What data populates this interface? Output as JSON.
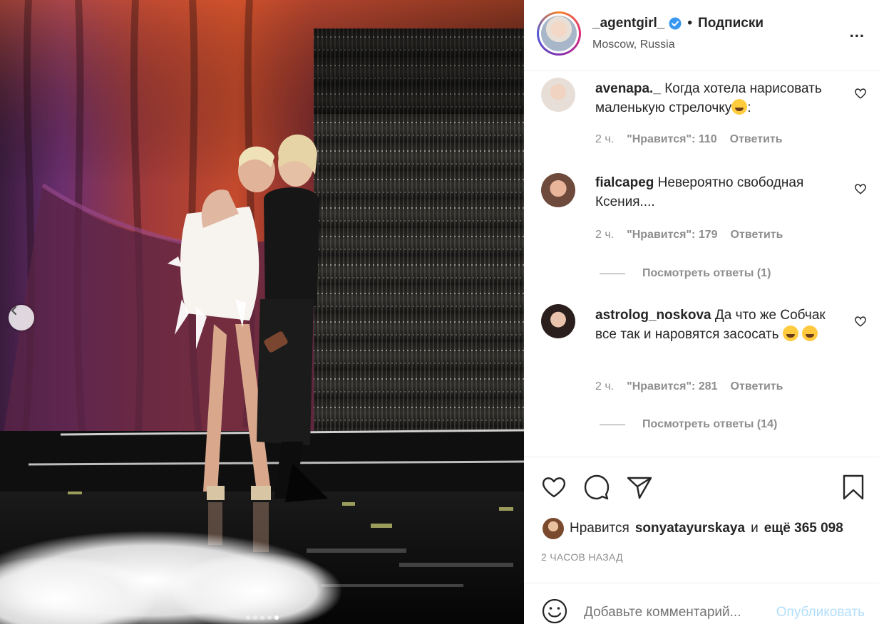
{
  "header": {
    "username": "_agentgirl_",
    "separator": "•",
    "follow_label": "Подписки",
    "location": "Moscow, Russia",
    "more_label": "..."
  },
  "comments": [
    {
      "username": "avenapa._",
      "text": "Когда хотела нарисовать маленькую стрелочку",
      "text_suffix": ":",
      "time": "2 ч.",
      "likes": "\"Нравится\": 110",
      "reply": "Ответить"
    },
    {
      "username": "fialcapeg",
      "text": "Невероятно свободная Ксения....",
      "time": "2 ч.",
      "likes": "\"Нравится\": 179",
      "reply": "Ответить",
      "view_replies": "Посмотреть ответы (1)"
    },
    {
      "username": "astrolog_noskova",
      "text": "Да что же Собчак все так и наровятся засосать",
      "time": "2 ч.",
      "likes": "\"Нравится\": 281",
      "reply": "Ответить",
      "view_replies": "Посмотреть ответы (14)"
    }
  ],
  "likes": {
    "prefix": "Нравится",
    "user": "sonyatayurskaya",
    "connector": "и",
    "others": "ещё 365 098"
  },
  "time_ago": "2 ЧАСОВ НАЗАД",
  "add_comment": {
    "placeholder": "Добавьте комментарий...",
    "publish": "Опубликовать"
  },
  "colors": {
    "verified": "#3897f0",
    "publish_disabled": "#b2dffc",
    "muted_text": "#8e8e8e"
  }
}
